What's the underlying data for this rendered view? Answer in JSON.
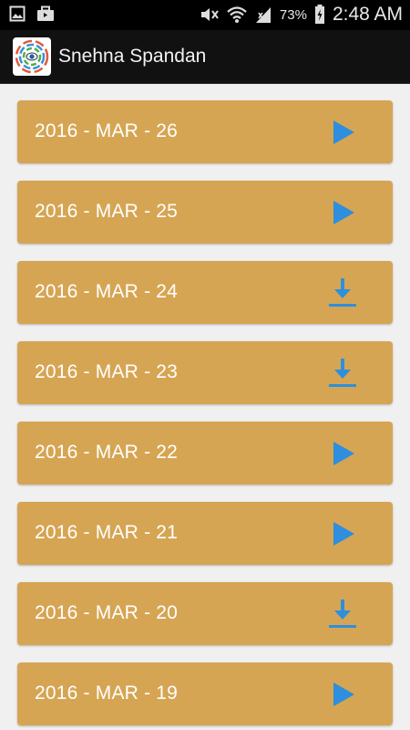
{
  "status_bar": {
    "battery": "73%",
    "time": "2:48 AM",
    "icons": [
      "image-icon",
      "briefcase-icon",
      "mute-icon",
      "wifi-icon",
      "signal-icon",
      "battery-charging-icon"
    ]
  },
  "app_bar": {
    "title": "Snehna Spandan",
    "logo_icon": "app-logo-icon"
  },
  "colors": {
    "card": "#d6a553",
    "icon": "#2d8fdd",
    "background": "#f0f0f0"
  },
  "items": [
    {
      "label": "2016 - MAR - 26",
      "action": "play-icon"
    },
    {
      "label": "2016 - MAR - 25",
      "action": "play-icon"
    },
    {
      "label": "2016 - MAR - 24",
      "action": "download-icon"
    },
    {
      "label": "2016 - MAR - 23",
      "action": "download-icon"
    },
    {
      "label": "2016 - MAR - 22",
      "action": "play-icon"
    },
    {
      "label": "2016 - MAR - 21",
      "action": "play-icon"
    },
    {
      "label": "2016 - MAR - 20",
      "action": "download-icon"
    },
    {
      "label": "2016 - MAR - 19",
      "action": "play-icon"
    }
  ]
}
